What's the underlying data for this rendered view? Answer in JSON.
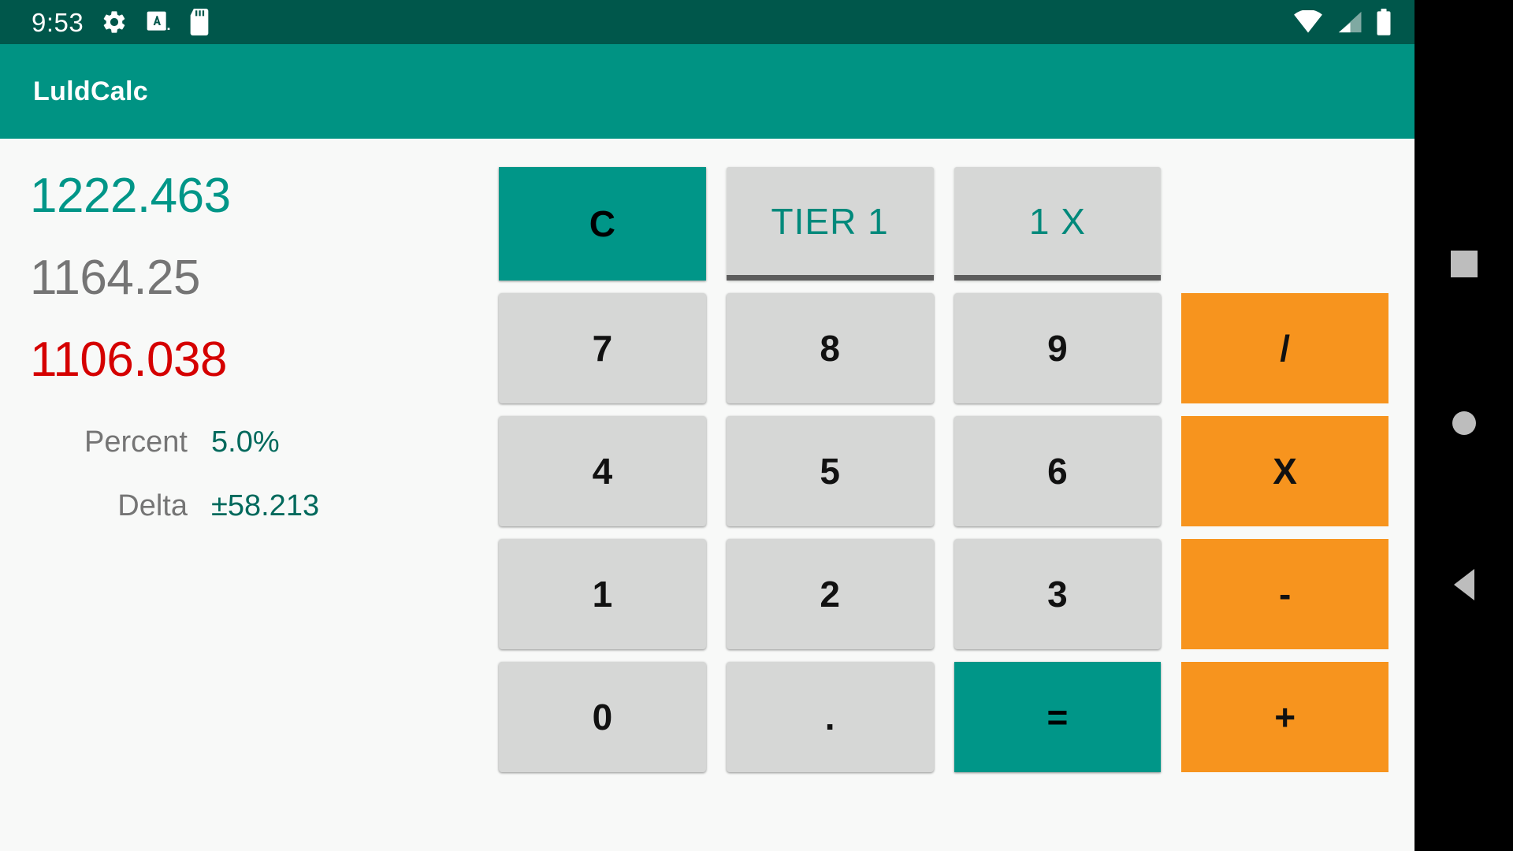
{
  "statusbar": {
    "time": "9:53",
    "icons_left": [
      "gear-icon",
      "a-badge-icon",
      "sd-card-icon"
    ],
    "icons_right": [
      "wifi-icon",
      "cellular-signal-icon",
      "battery-icon"
    ],
    "background": "#00574B"
  },
  "appbar": {
    "title": "LuldCalc",
    "background": "#009383"
  },
  "results": {
    "upper_band": "1222.463",
    "reference_price": "1164.25",
    "lower_band": "1106.038",
    "percent_label": "Percent",
    "percent_value": "5.0%",
    "delta_label": "Delta",
    "delta_value": "±58.213",
    "colors": {
      "upper": "#009688",
      "reference": "#757575",
      "lower": "#D50000",
      "kv_label": "#757575",
      "kv_value": "#00695C"
    }
  },
  "keypad": {
    "clear_label": "C",
    "tier_label": "TIER 1",
    "multiplier_label": "1 X",
    "rows": [
      {
        "keys": [
          "7",
          "8",
          "9"
        ],
        "op": "/"
      },
      {
        "keys": [
          "4",
          "5",
          "6"
        ],
        "op": "X"
      },
      {
        "keys": [
          "1",
          "2",
          "3"
        ],
        "op": "-"
      },
      {
        "keys": [
          "0",
          ".",
          "="
        ],
        "op": "+"
      }
    ],
    "colors": {
      "number": "#D6D7D6",
      "accent": "#009688",
      "operator": "#F7941E"
    }
  },
  "navbar": {
    "recent_label": "recent-apps",
    "home_label": "home",
    "back_label": "back"
  }
}
